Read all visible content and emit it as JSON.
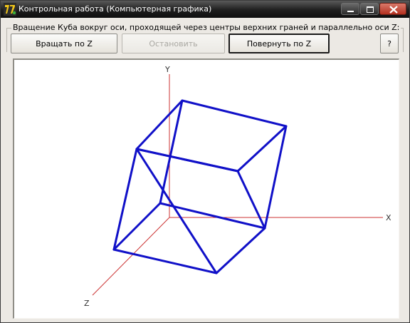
{
  "window": {
    "title": "Контрольная работа (Компьютерная графика)",
    "icon": "delphi-app-icon",
    "controls": [
      "minimize-icon",
      "maximize-icon",
      "close-icon"
    ]
  },
  "group": {
    "caption": "Вращение Куба вокруг оси, проходящей через центры верхних граней и параллельно оси Z:"
  },
  "toolbar": {
    "rotate_label": "Вращать по Z",
    "stop_label": "Остановить",
    "stop_enabled": false,
    "turn_label": "Повернуть по Z",
    "help_label": "?"
  },
  "scene": {
    "axes": {
      "x_label": "X",
      "y_label": "Y",
      "z_label": "Z",
      "axis_color": "#cc3333"
    },
    "cube": {
      "edge_color": "#1010c8"
    }
  }
}
